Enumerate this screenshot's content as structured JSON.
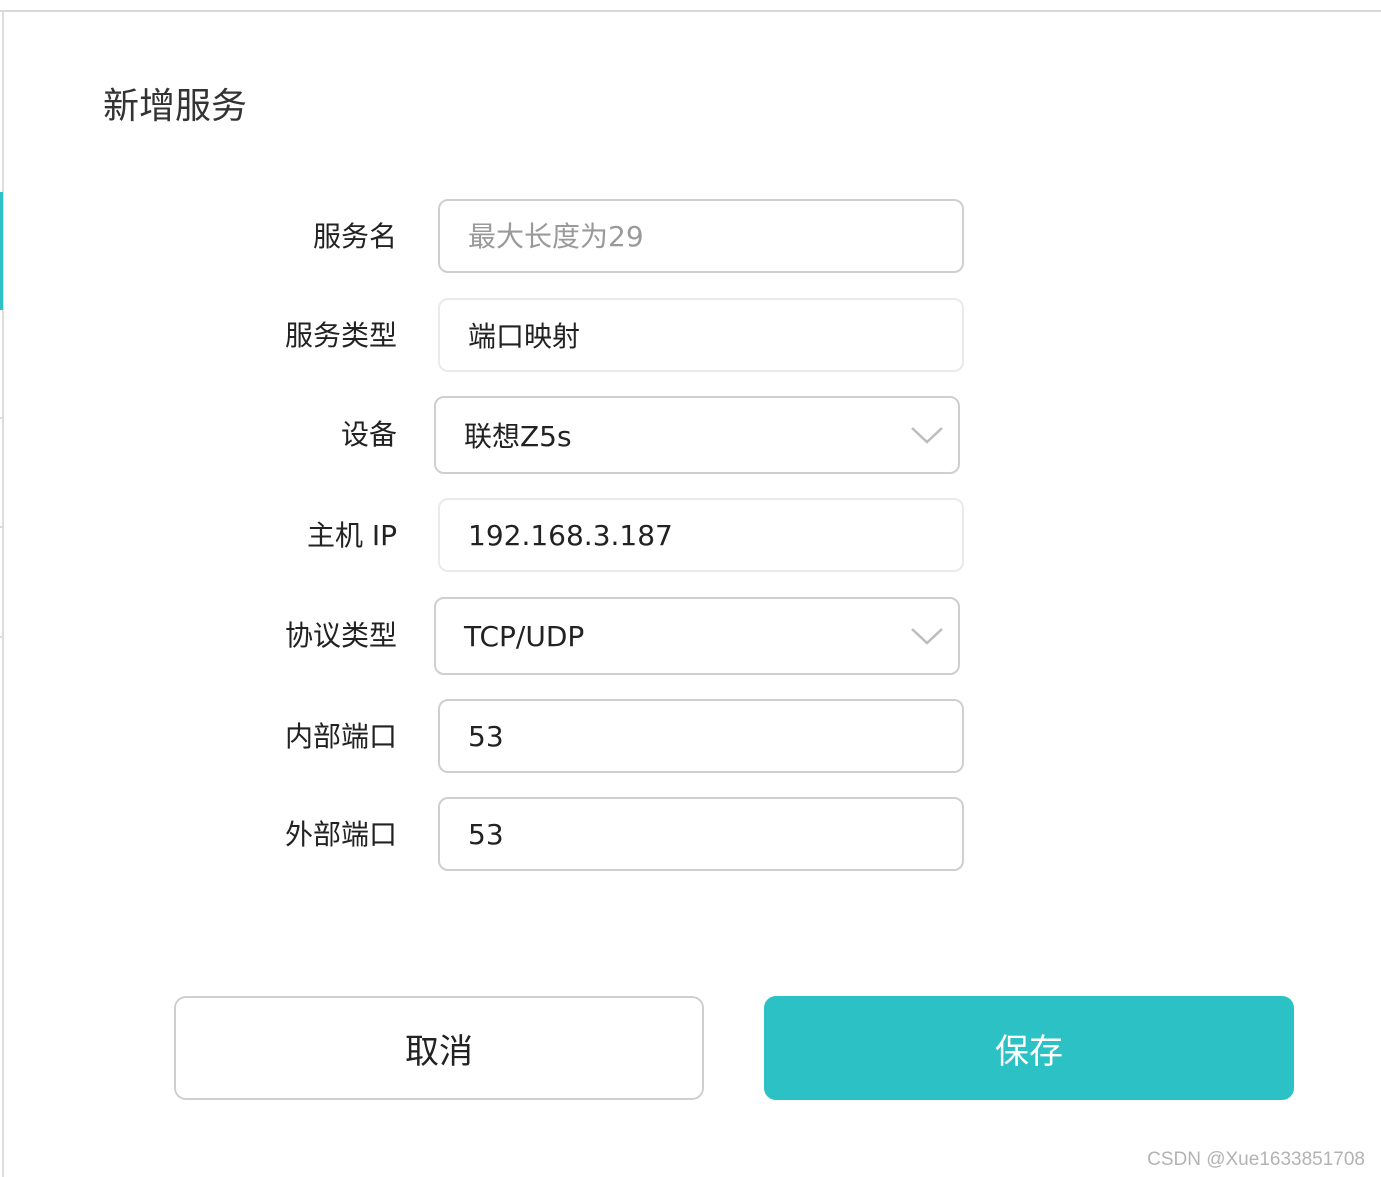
{
  "dialog": {
    "title": "新增服务"
  },
  "form": {
    "service_name": {
      "label": "服务名",
      "value": "",
      "placeholder": "最大长度为29"
    },
    "service_type": {
      "label": "服务类型",
      "value": "端口映射"
    },
    "device": {
      "label": "设备",
      "value": "联想Z5s"
    },
    "host_ip": {
      "label": "主机 IP",
      "value": "192.168.3.187"
    },
    "protocol": {
      "label": "协议类型",
      "value": "TCP/UDP"
    },
    "internal_port": {
      "label": "内部端口",
      "value": "53"
    },
    "external_port": {
      "label": "外部端口",
      "value": "53"
    }
  },
  "actions": {
    "cancel_label": "取消",
    "save_label": "保存"
  },
  "colors": {
    "accent": "#2bc1c5",
    "border": "#cfcfcf",
    "placeholder": "#9a9a9a"
  },
  "watermark": "CSDN @Xue1633851708"
}
